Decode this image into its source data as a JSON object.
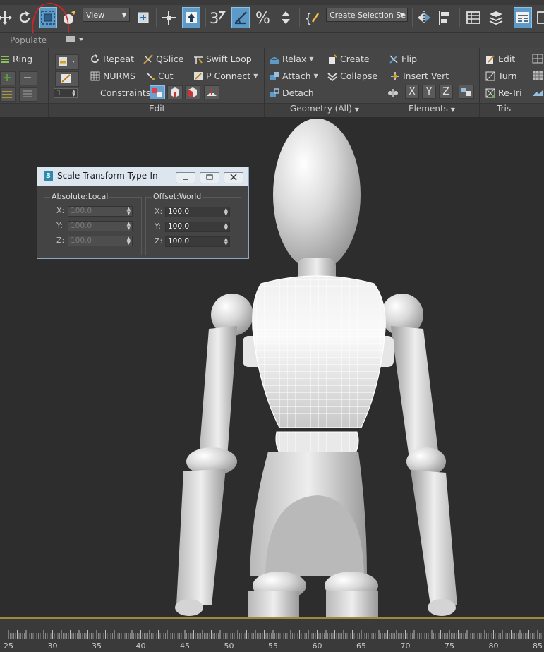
{
  "toolbar": {
    "view_dropdown": "View",
    "selection_set_dropdown": "Create Selection Se"
  },
  "subbar": {
    "populate": "Populate"
  },
  "ribbon": {
    "ring": "Ring",
    "spinner_value": "1",
    "repeat": "Repeat",
    "qslice": "QSlice",
    "swift_loop": "Swift Loop",
    "nurms": "NURMS",
    "cut": "Cut",
    "p_connect": "P Connect",
    "constraints": "Constraints:",
    "relax": "Relax",
    "create": "Create",
    "attach": "Attach",
    "collapse": "Collapse",
    "detach": "Detach",
    "flip": "Flip",
    "insert_vert": "Insert Vert",
    "x": "X",
    "y": "Y",
    "z": "Z",
    "edit": "Edit",
    "turn": "Turn",
    "re_tri": "Re-Tri",
    "panel_edit": "Edit",
    "panel_geometry": "Geometry (All)",
    "panel_elements": "Elements",
    "panel_tris": "Tris"
  },
  "dialog": {
    "icon_number": "3",
    "title": "Scale Transform Type-In",
    "absolute_group": "Absolute:Local",
    "offset_group": "Offset:World",
    "abs": [
      {
        "label": "X:",
        "value": "100.0"
      },
      {
        "label": "Y:",
        "value": "100.0"
      },
      {
        "label": "Z:",
        "value": "100.0"
      }
    ],
    "off": [
      {
        "label": "X:",
        "value": "100.0"
      },
      {
        "label": "Y:",
        "value": "100.0"
      },
      {
        "label": "Z:",
        "value": "100.0"
      }
    ]
  },
  "timeline": {
    "labels": [
      "25",
      "30",
      "35",
      "40",
      "45",
      "50",
      "55",
      "60",
      "65",
      "70",
      "75",
      "80",
      "85"
    ]
  },
  "colors": {
    "active_button": "#5d9ac8",
    "constraint_active": "#6a9fd0",
    "annotation_circle": "#e02020",
    "viewport_frame": "#9a8a3a"
  }
}
